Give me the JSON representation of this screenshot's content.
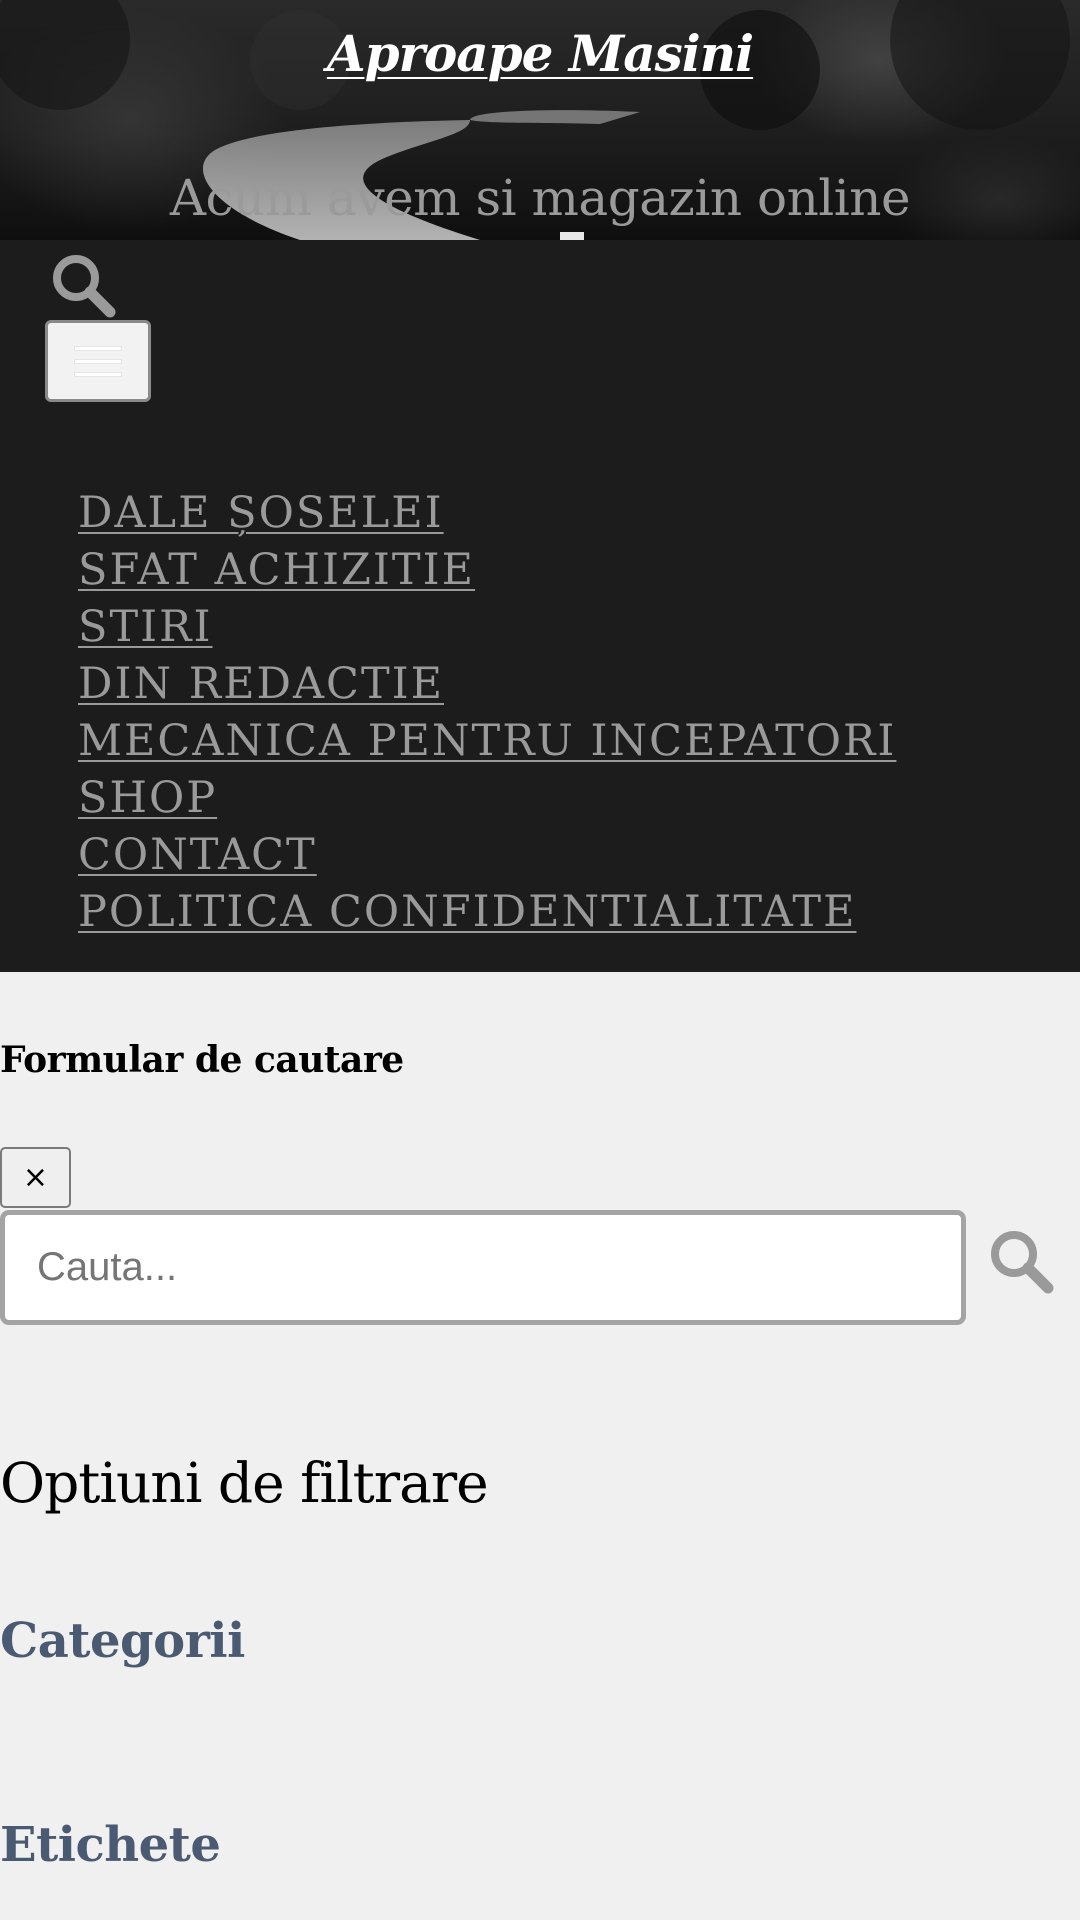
{
  "header": {
    "site_title": "Aproape Masini",
    "tagline": "Acum avem si magazin online"
  },
  "nav": {
    "search_toggle_icon": "search-icon",
    "menu_toggle_icon": "hamburger-icon",
    "items": [
      {
        "label": "DALE ȘOSELEI"
      },
      {
        "label": "SFAT ACHIZITIE"
      },
      {
        "label": "STIRI"
      },
      {
        "label": "DIN REDACTIE"
      },
      {
        "label": "MECANICA PENTRU INCEPATORI"
      },
      {
        "label": "SHOP"
      },
      {
        "label": "CONTACT"
      },
      {
        "label": "POLITICA CONFIDENTIALITATE"
      }
    ]
  },
  "search": {
    "heading": "Formular de cautare",
    "close_label": "×",
    "placeholder": "Cauta...",
    "submit_icon": "search-icon"
  },
  "filters": {
    "heading": "Optiuni de filtrare",
    "categories_label": "Categorii",
    "tags_label": "Etichete"
  },
  "colors": {
    "nav_background": "#1c1c1c",
    "menu_link": "#9a9a9a",
    "page_background": "#f0f0f0",
    "filter_subheading": "#4a5a72",
    "search_icon": "#9a9a9a"
  }
}
